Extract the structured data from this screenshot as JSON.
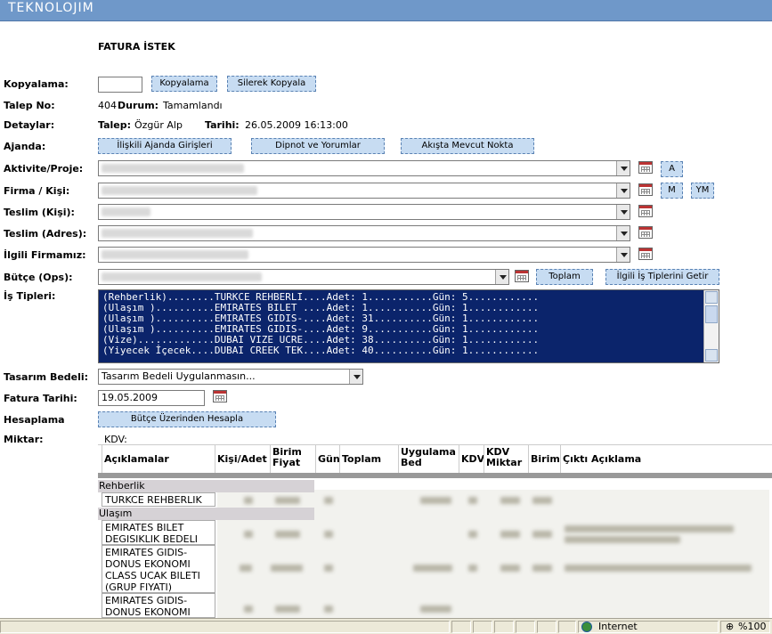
{
  "app": {
    "logo": "TEKNOLOJIM"
  },
  "page": {
    "title": "FATURA İSTEK"
  },
  "labels": {
    "kopyalama": "Kopyalama:",
    "talep_no": "Talep No:",
    "detaylar": "Detaylar:",
    "ajanda": "Ajanda:",
    "aktivite": "Aktivite/Proje:",
    "firma": "Firma / Kişi:",
    "teslim_kisi": "Teslim (Kişi):",
    "teslim_adres": "Teslim (Adres):",
    "ilgili_firma": "İlgili Firmamız:",
    "butce": "Bütçe (Ops):",
    "is_tipleri": "İş Tipleri:",
    "tasarim_bedeli": "Tasarım Bedeli:",
    "fatura_tarihi": "Fatura Tarihi:",
    "hesaplama": "Hesaplama",
    "miktar": "Miktar:"
  },
  "buttons": {
    "kopyala": "Kopyalama",
    "silerek_kopyala": "Silerek Kopyala",
    "iliskili_ajanda": "İlişkili Ajanda Girişleri",
    "dipnot": "Dipnot ve Yorumlar",
    "akista": "Akışta Mevcut Nokta",
    "a": "A",
    "m": "M",
    "ym": "YM",
    "toplam": "Toplam",
    "ilgili_is_tipleri": "İlgili İş Tiplerini Getir",
    "butce_hesapla": "Bütçe Üzerinden Hesapla"
  },
  "talep": {
    "no": "404",
    "durum_label": "Durum:",
    "durum": "Tamamlandı",
    "talep_label": "Talep:",
    "talep_eden": "Özgür Alp",
    "tarih_label": "Tarihi:",
    "tarih": "26.05.2009 16:13:00"
  },
  "is_tipleri": [
    "(Rehberlik)........TURKCE REHBERLI....Adet: 1...........Gün: 5............",
    "(Ulaşım )..........EMIRATES BILET ....Adet: 1...........Gün: 1............",
    "(Ulaşım )..........EMIRATES GIDIS-....Adet: 31..........Gün: 1............",
    "(Ulaşım )..........EMIRATES GIDIS-....Adet: 9...........Gün: 1............",
    "(Vize).............DUBAI VIZE UCRE....Adet: 38..........Gün: 1............",
    "(Yiyecek İçecek....DUBAI CREEK TEK....Adet: 40..........Gün: 1............"
  ],
  "tasarim_bedeli": {
    "selected": "Tasarım Bedeli Uygulanmasın..."
  },
  "fatura_tarihi": {
    "value": "19.05.2009"
  },
  "kdv_label": "KDV:",
  "grid": {
    "headers": [
      "Açıklamalar",
      "Kişi/Adet",
      "Birim Fiyat",
      "Gün",
      "Toplam",
      "Uygulama Bed",
      "KDV",
      "KDV Miktar",
      "Birim",
      "Çıktı Açıklama"
    ],
    "groups": [
      {
        "name": "Rehberlik",
        "rows": [
          "TURKCE REHBERLIK"
        ]
      },
      {
        "name": "Ulaşım",
        "rows": [
          "EMIRATES BILET DEGISIKLIK BEDELI",
          "EMIRATES GIDIS-DONUS EKONOMI CLASS UCAK BILETI (GRUP FIYATI)",
          "EMIRATES GIDIS-DONUS EKONOMI"
        ]
      }
    ]
  },
  "status_bar": {
    "zone": "Internet",
    "zoom": "%100"
  }
}
